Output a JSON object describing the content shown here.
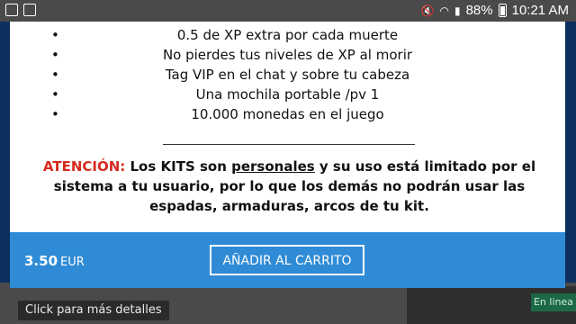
{
  "status_bar": {
    "battery": "88%",
    "time": "10:21 AM"
  },
  "benefits": [
    "0.5 de XP extra por cada muerte",
    "No pierdes tus niveles de XP al morir",
    "Tag VIP en el chat y sobre tu cabeza",
    "Una mochila portable /pv 1",
    "10.000 monedas en el juego"
  ],
  "divider": "_______________________________________",
  "notice": {
    "label": "ATENCIÓN:",
    "text_before": " Los KITS son ",
    "emphasis": "personales",
    "text_after": " y su uso está limitado por el sistema a tu usuario, por lo que los demás no podrán usar las espadas, armaduras, arcos de tu kit."
  },
  "cart": {
    "price": "3.50",
    "currency": "EUR",
    "add_button_label": "AÑADIR AL CARRITO"
  },
  "tooltip": "Click para más detalles",
  "online_badge": "En linea",
  "colors": {
    "accent": "#2f8bd6",
    "warning": "#d62a1e"
  }
}
